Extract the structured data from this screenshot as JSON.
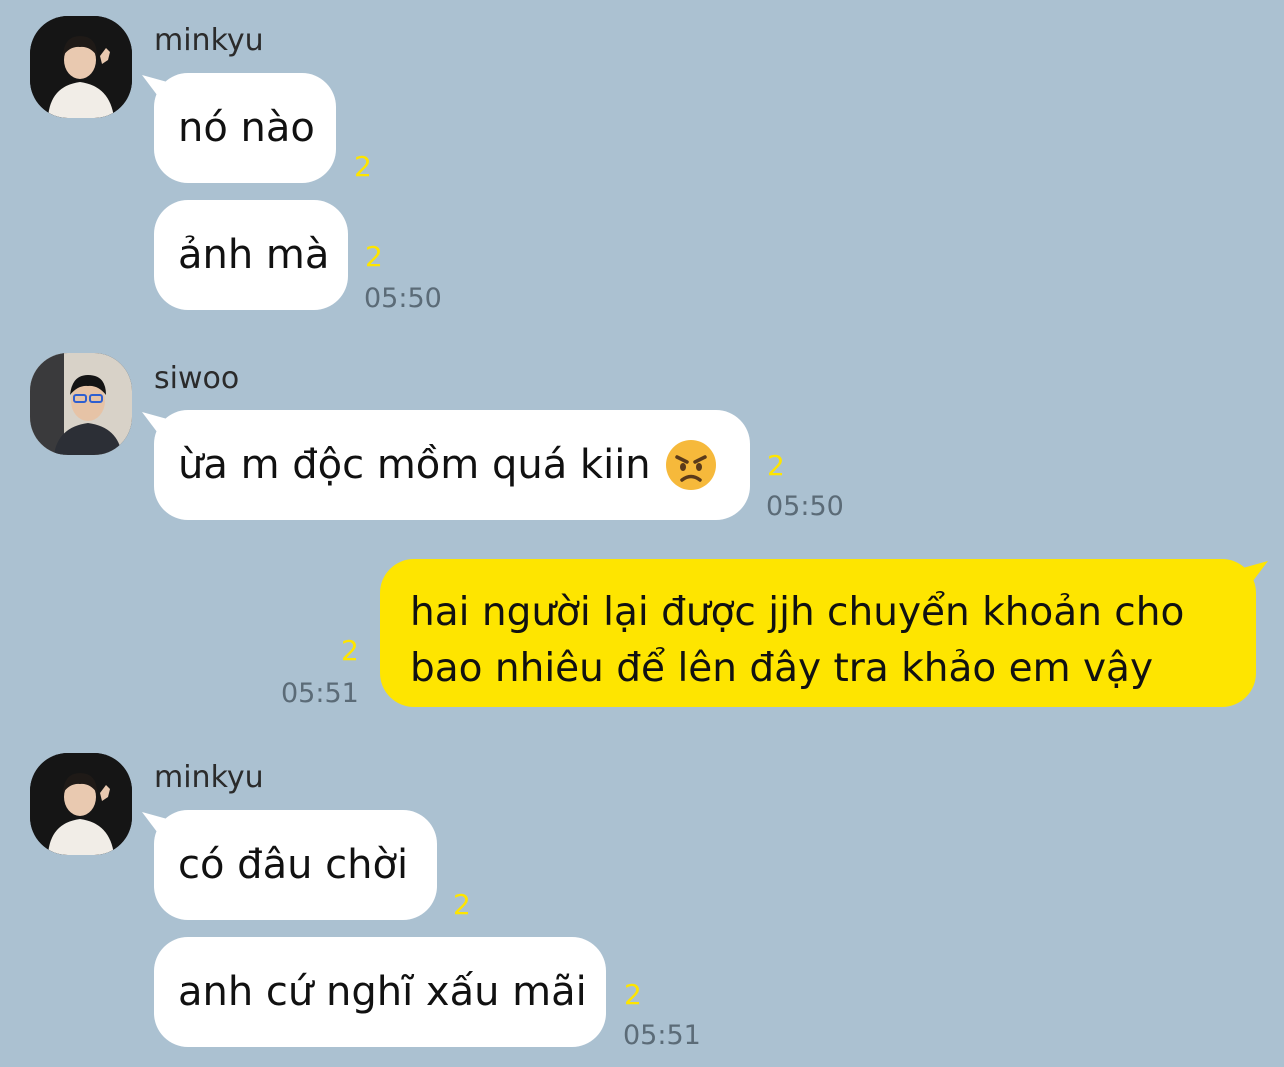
{
  "messages": [
    {
      "sender": "minkyu",
      "text": "nó nào",
      "unread": "2"
    },
    {
      "sender": "minkyu",
      "text": "ảnh mà",
      "unread": "2",
      "time": "05:50"
    },
    {
      "sender": "siwoo",
      "text": "ừa m độc mồm quá kiin",
      "emoji": "angry-face-emoji",
      "unread": "2",
      "time": "05:50"
    },
    {
      "sender": "me",
      "text": "hai người lại được jjh chuyển khoản cho bao nhiêu để lên đây tra khảo em vậy",
      "unread": "2",
      "time": "05:51"
    },
    {
      "sender": "minkyu",
      "text": "có đâu chời",
      "unread": "2"
    },
    {
      "sender": "minkyu",
      "text": "anh cứ nghĩ xấu mãi",
      "unread": "2",
      "time": "05:51"
    }
  ],
  "colors": {
    "background": "#abc1d1",
    "incoming_bubble": "#ffffff",
    "outgoing_bubble": "#fee500",
    "unread": "#fee500",
    "timestamp": "#5b6b77"
  }
}
